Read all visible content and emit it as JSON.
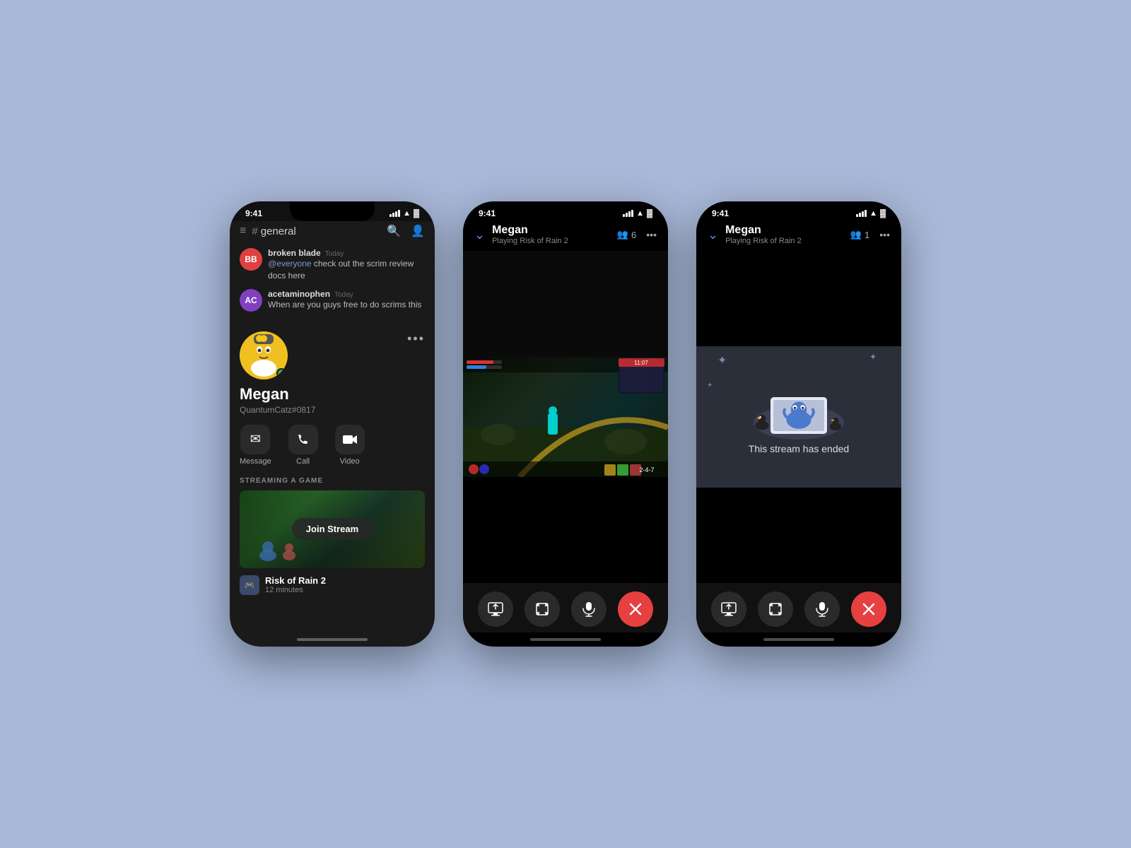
{
  "background_color": "#a8b8d8",
  "phones": [
    {
      "id": "phone1",
      "status_time": "9:41",
      "top_bar": {
        "channel": "general",
        "hash_symbol": "#"
      },
      "messages": [
        {
          "username": "broken blade",
          "time": "Today",
          "avatar_color": "#e04040",
          "initials": "BB",
          "text": "@everyone check out the scrim review docs here"
        },
        {
          "username": "acetaminophen",
          "time": "Today",
          "avatar_color": "#8040c0",
          "initials": "AC",
          "text": "When are you guys free to do scrims this"
        }
      ],
      "profile": {
        "name": "Megan",
        "tag": "QuantumCatz#0817",
        "actions": [
          {
            "label": "Message",
            "icon": "✉"
          },
          {
            "label": "Call",
            "icon": "📞"
          },
          {
            "label": "Video",
            "icon": "📹"
          }
        ]
      },
      "streaming": {
        "label": "STREAMING A GAME",
        "join_btn": "Join Stream",
        "game_name": "Risk of Rain 2",
        "game_time": "12 minutes"
      }
    },
    {
      "id": "phone2",
      "status_time": "9:41",
      "header": {
        "name": "Megan",
        "sub": "Playing Risk of Rain 2",
        "viewers": "6"
      },
      "controls": [
        {
          "icon": "⬛",
          "type": "share-screen"
        },
        {
          "icon": "⬜",
          "type": "fullscreen"
        },
        {
          "icon": "🎤",
          "type": "mic"
        },
        {
          "icon": "✕",
          "type": "end-call",
          "red": true
        }
      ]
    },
    {
      "id": "phone3",
      "status_time": "9:41",
      "header": {
        "name": "Megan",
        "sub": "Playing Risk of Rain 2",
        "viewers": "1"
      },
      "stream_ended_text": "This stream has ended",
      "controls": [
        {
          "icon": "⬛",
          "type": "share-screen"
        },
        {
          "icon": "⬜",
          "type": "fullscreen"
        },
        {
          "icon": "🎤",
          "type": "mic"
        },
        {
          "icon": "✕",
          "type": "end-call",
          "red": true
        }
      ]
    }
  ]
}
